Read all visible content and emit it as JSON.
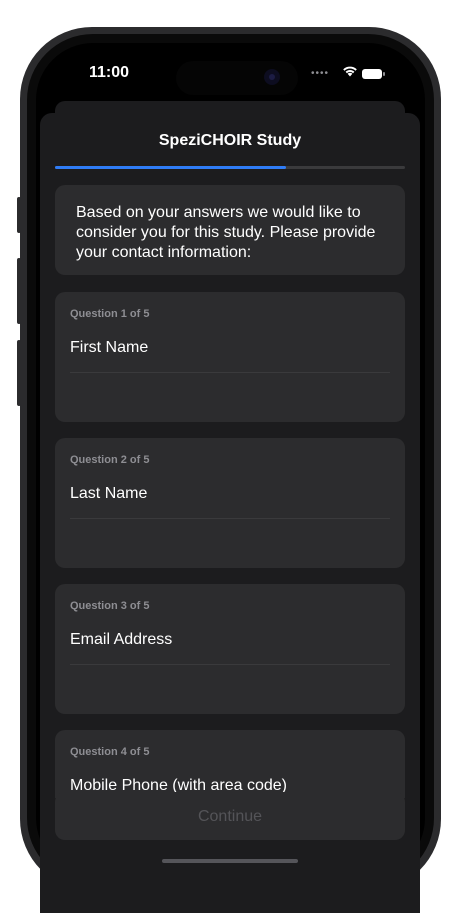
{
  "status_bar": {
    "time": "11:00"
  },
  "nav": {
    "title": "SpeziCHOIR Study"
  },
  "progress": {
    "fraction": 0.66,
    "color": "#2f7cf6"
  },
  "intro": {
    "text": "Based on your answers we would like to consider you for this study. Please provide your contact information:"
  },
  "questions": [
    {
      "label": "Question 1 of 5",
      "text": "First Name"
    },
    {
      "label": "Question 2 of 5",
      "text": "Last Name"
    },
    {
      "label": "Question 3 of 5",
      "text": "Email Address"
    },
    {
      "label": "Question 4 of 5",
      "text": "Mobile Phone (with area code)"
    }
  ],
  "footer": {
    "continue_label": "Continue"
  },
  "colors": {
    "background": "#1c1c1e",
    "card": "#2c2c2e",
    "accent": "#2f7cf6",
    "secondary_text": "#8e8e93",
    "disabled_text": "#545458"
  },
  "icons": [
    "wifi-icon",
    "battery-icon",
    "signal-icon"
  ]
}
